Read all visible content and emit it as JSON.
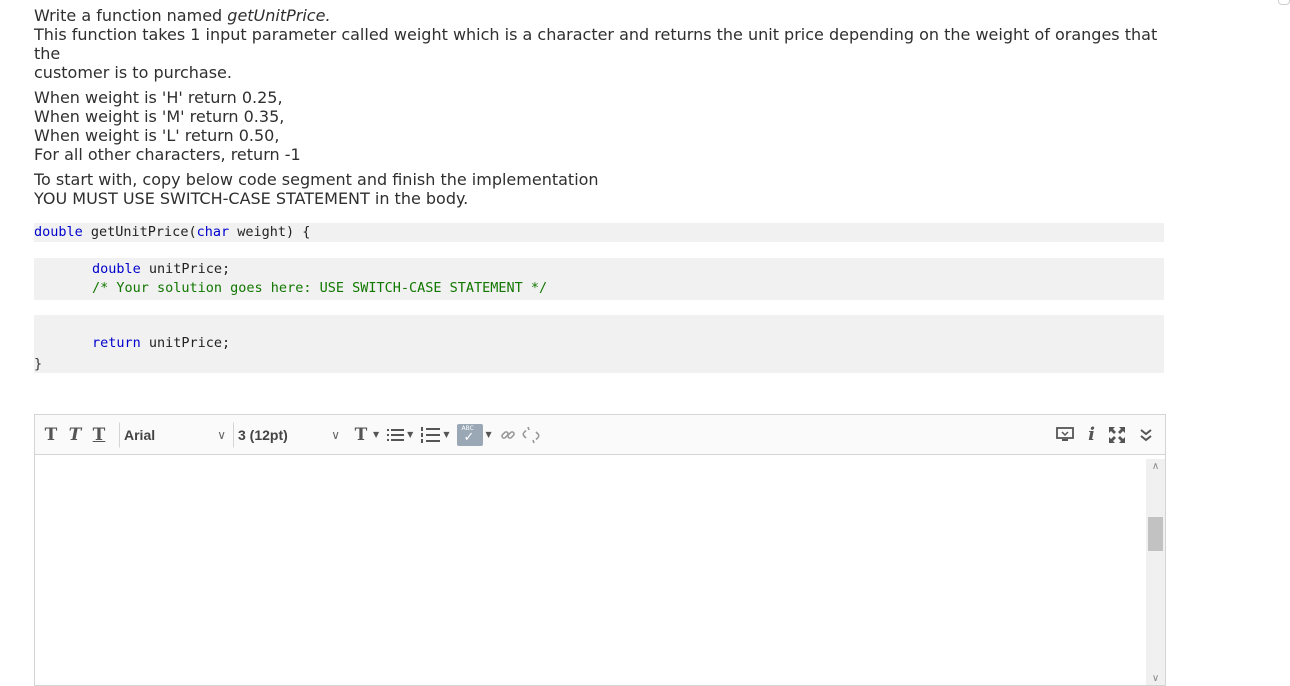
{
  "question": {
    "line1_prefix": "Write a function named ",
    "function_name": "getUnitPrice.",
    "line2": "This function takes 1 input parameter called weight which is a character and returns the unit price depending on the weight of oranges that the",
    "line3": "customer is to purchase.",
    "rules": [
      "When weight is 'H' return 0.25,",
      "When weight is 'M' return 0.35,",
      "When weight is 'L' return 0.50,",
      "For all other characters, return -1"
    ],
    "instruction1": "To start with, copy below code segment and finish the implementation",
    "instruction2": "YOU MUST USE SWITCH-CASE STATEMENT in the body."
  },
  "code": {
    "sig_kw1": "double",
    "sig_name": " getUnitPrice(",
    "sig_kw2": "char",
    "sig_rest": " weight) {",
    "decl_kw": "double",
    "decl_rest": " unitPrice;",
    "comment": "/* Your solution goes here: USE SWITCH-CASE STATEMENT */",
    "return_kw": "return",
    "return_rest": " unitPrice;",
    "closing": "}"
  },
  "editor": {
    "font_family_value": "Arial",
    "font_size_value": "3 (12pt)",
    "spell_label": "ABC",
    "tool_icons": [
      "text-bold-icon",
      "text-italic-icon",
      "text-underline-icon",
      "text-color-icon",
      "bullet-list-icon",
      "numbered-list-icon",
      "spellcheck-icon",
      "link-icon",
      "unlink-icon",
      "preview-icon",
      "info-icon",
      "fullscreen-icon",
      "expand-toolbar-icon"
    ]
  },
  "colors": {
    "keyword": "#0000cc",
    "comment": "#117700",
    "code_bg": "#f1f1f1"
  }
}
